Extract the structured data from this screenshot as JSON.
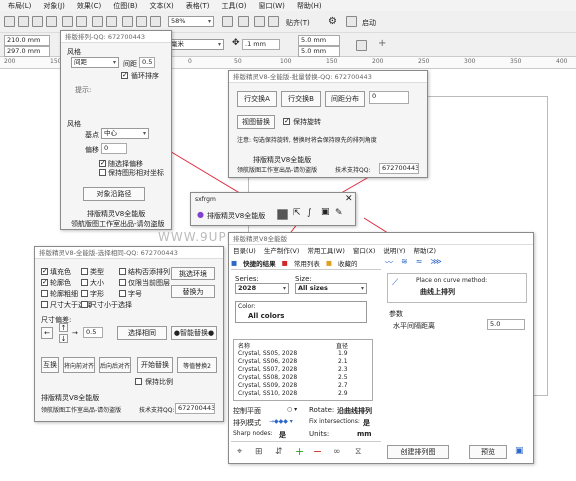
{
  "menubar": [
    "布局(L)",
    "对象(J)",
    "效果(C)",
    "位图(B)",
    "文本(X)",
    "表格(T)",
    "工具(O)",
    "窗口(W)",
    "帮助(H)"
  ],
  "toolbar": {
    "zoom": "58%",
    "snap": "贴齐(T)",
    "launch": "启动"
  },
  "propbar": {
    "width": "210.0 mm",
    "height": "297.0 mm",
    "unit_select": "毫米",
    "nudge": ".1 mm",
    "dup_x": "5.0 mm",
    "dup_y": "5.0 mm"
  },
  "ruler": {
    "ticks": [
      "200",
      "150",
      "100",
      "50",
      "0",
      "50",
      "100",
      "150",
      "200",
      "250",
      "300",
      "350",
      "400"
    ]
  },
  "dlg_arrange": {
    "title": "排版排列-QQ: 672700443",
    "section_style": "风格",
    "select1": "间距",
    "spacing_label": "间距",
    "spacing_value": "0.5",
    "loop_label": "循环排序",
    "note": "提示:",
    "section_style2": "风格",
    "base_label": "基点",
    "base_value": "中心",
    "offset_label": "偏移",
    "offset_value": "0",
    "cb1": "随选择偏移",
    "cb2": "保持图形相对坐标",
    "btn_path": "对象沿路径",
    "footer1": "排版精灵V8全能版",
    "footer2": "领航版图工作室出品-请勿盗版"
  },
  "dlg_replace": {
    "title": "排版精灵V8-全能版-批量替换-QQ: 672700443",
    "btn_a": "行交换A",
    "btn_b": "行交换B",
    "btn_dist": "间距分布",
    "dist_value": "0",
    "btn_swap": "视图替换",
    "cb_keep": "保持旋转",
    "note": "注意: 勾选保持旋转, 替换时将会保持原先的排列角度",
    "footer1": "排版精灵V8全能版",
    "footer2": "领航版图工作室出品-请勿盗版",
    "qq_label": "技术支持QQ:",
    "qq_value": "672700443"
  },
  "mini_panel": {
    "title": "sxfrgm",
    "label": "排版精灵V8全能版"
  },
  "watermark": "WWW.9UPK.COM",
  "dlg_select": {
    "title": "排版精灵V8-全能版-选择相同-QQ: 672700443",
    "checks": [
      [
        "填充色",
        "类型",
        "结构否添排列"
      ],
      [
        "轮廓色",
        "大小",
        "仅限当前图层"
      ],
      [
        "轮廓粗细",
        "字形",
        "字号"
      ],
      [
        "尺寸大于选择",
        "尺寸小于选择",
        ""
      ]
    ],
    "checks_on": [
      [
        true,
        false,
        false
      ],
      [
        true,
        false,
        false
      ],
      [
        false,
        false,
        false
      ],
      [
        false,
        false,
        false
      ]
    ],
    "btn_select_similar": "挑选环境",
    "btn_replace": "替换为",
    "size_label": "尺寸偏差:",
    "size_value": "0.5",
    "btn_select_same": "选择相同",
    "btn_smart": "●智能替换●",
    "btn_swap": "互换",
    "btn_up": "将向前对齐",
    "btn_down": "后向后对齐",
    "btn_start": "开始替换",
    "btn_replace2": "等值替换2",
    "cb_keep_ratio": "保持比例",
    "footer1": "排版精灵V8全能版",
    "footer2": "领航版图工作室出品-请勿盗版",
    "qq_label": "技术支持QQ:",
    "qq_value": "672700443"
  },
  "arr_arrow_colors": {
    "line": "#e0283c"
  },
  "fitpanel": {
    "title": "排版精灵V8全能版",
    "menu": [
      "目录(U)",
      "生产制作(V)",
      "常用工具(W)",
      "窗口(X)",
      "说明(Y)",
      "帮助(Z)"
    ],
    "tabs": [
      "快捷的结果",
      "常用列表",
      "收藏的"
    ],
    "series_label": "Series:",
    "series_value": "2028",
    "size_label": "Size:",
    "size_value": "All sizes",
    "color_label": "Color:",
    "color_value": "All colors",
    "list_header_name": "名称",
    "list_header_size": "直径",
    "rows": [
      [
        "Crystal, SS05, 2028",
        "1.9"
      ],
      [
        "Crystal, SS06, 2028",
        "2.1"
      ],
      [
        "Crystal, SS07, 2028",
        "2.3"
      ],
      [
        "Crystal, SS08, 2028",
        "2.5"
      ],
      [
        "Crystal, SS09, 2028",
        "2.7"
      ],
      [
        "Crystal, SS10, 2028",
        "2.9"
      ]
    ],
    "place_label": "控制平面",
    "rotate_label": "Rotate:",
    "rotate_value": "沿曲线排列",
    "seq_label": "排列模式",
    "fix_label": "Fix intersections:",
    "fix_value": "是",
    "sharp_label": "Sharp nodes:",
    "sharp_value": "是",
    "units_label": "Units:",
    "units_value": "mm",
    "right_method_label": "Place on curve method:",
    "right_method_value": "曲线上排列",
    "param_label": "参数",
    "gap_label": "水平间隔距离",
    "gap_value": "5.0",
    "btn_create": "创建排列图",
    "btn_preview": "预览"
  }
}
